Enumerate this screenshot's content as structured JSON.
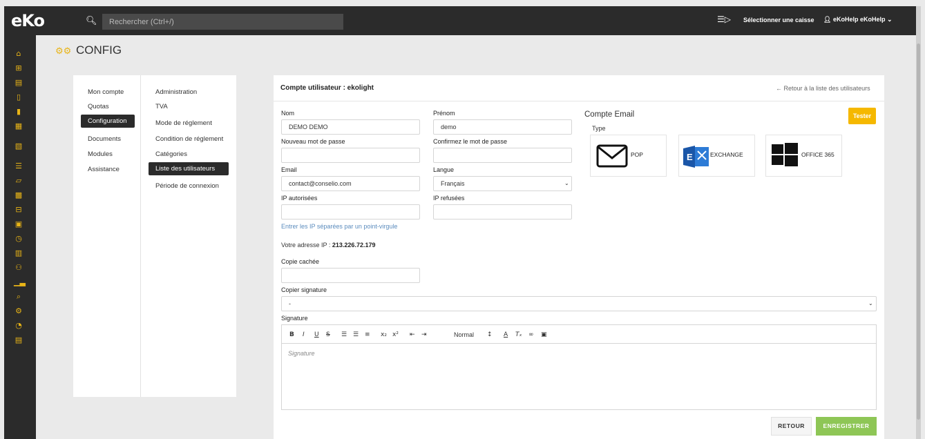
{
  "app": {
    "logo": "eKo"
  },
  "header": {
    "search_placeholder": "Rechercher (Ctrl+/)",
    "caisse_label": "Sélectionner une caisse",
    "user_label": "eKoHelp eKoHelp"
  },
  "page": {
    "title": "CONFIG"
  },
  "menu": {
    "left": [
      "Mon compte",
      "Quotas",
      "Configuration",
      "Documents",
      "Modules",
      "Assistance"
    ],
    "right": [
      "Administration",
      "TVA",
      "Mode de réglement",
      "Condition de réglement",
      "Catégories",
      "Liste des utilisateurs",
      "Période de connexion"
    ]
  },
  "form": {
    "title": "Compte utilisateur : ekolight",
    "back_link": "Retour à la liste des utilisateurs",
    "nom_label": "Nom",
    "nom_value": "DEMO DEMO",
    "prenom_label": "Prénom",
    "prenom_value": "demo",
    "new_pwd_label": "Nouveau mot de passe",
    "confirm_pwd_label": "Confirmez le mot de passe",
    "email_label": "Email",
    "email_value": "contact@conselio.com",
    "langue_label": "Langue",
    "langue_value": "Français",
    "ip_auth_label": "IP autorisées",
    "ip_ref_label": "IP refusées",
    "ip_hint": "Entrer les IP séparées par un point-virgule",
    "ip_text": "Votre adresse IP :",
    "ip_value": "213.226.72.179",
    "copie_label": "Copie cachée",
    "copier_signature_label": "Copier signature",
    "copier_signature_value": "-",
    "signature_label": "Signature",
    "signature_placeholder": "Signature",
    "editor_heading": "Normal",
    "email_account_title": "Compte Email",
    "type_label": "Type",
    "email_types": [
      "POP",
      "EXCHANGE",
      "OFFICE 365"
    ],
    "tester_label": "Tester",
    "retour_label": "RETOUR",
    "save_label": "ENREGISTRER"
  },
  "colors": {
    "accent": "#f5b800",
    "success": "#8ec656",
    "sidebar": "#2b2b2b"
  }
}
